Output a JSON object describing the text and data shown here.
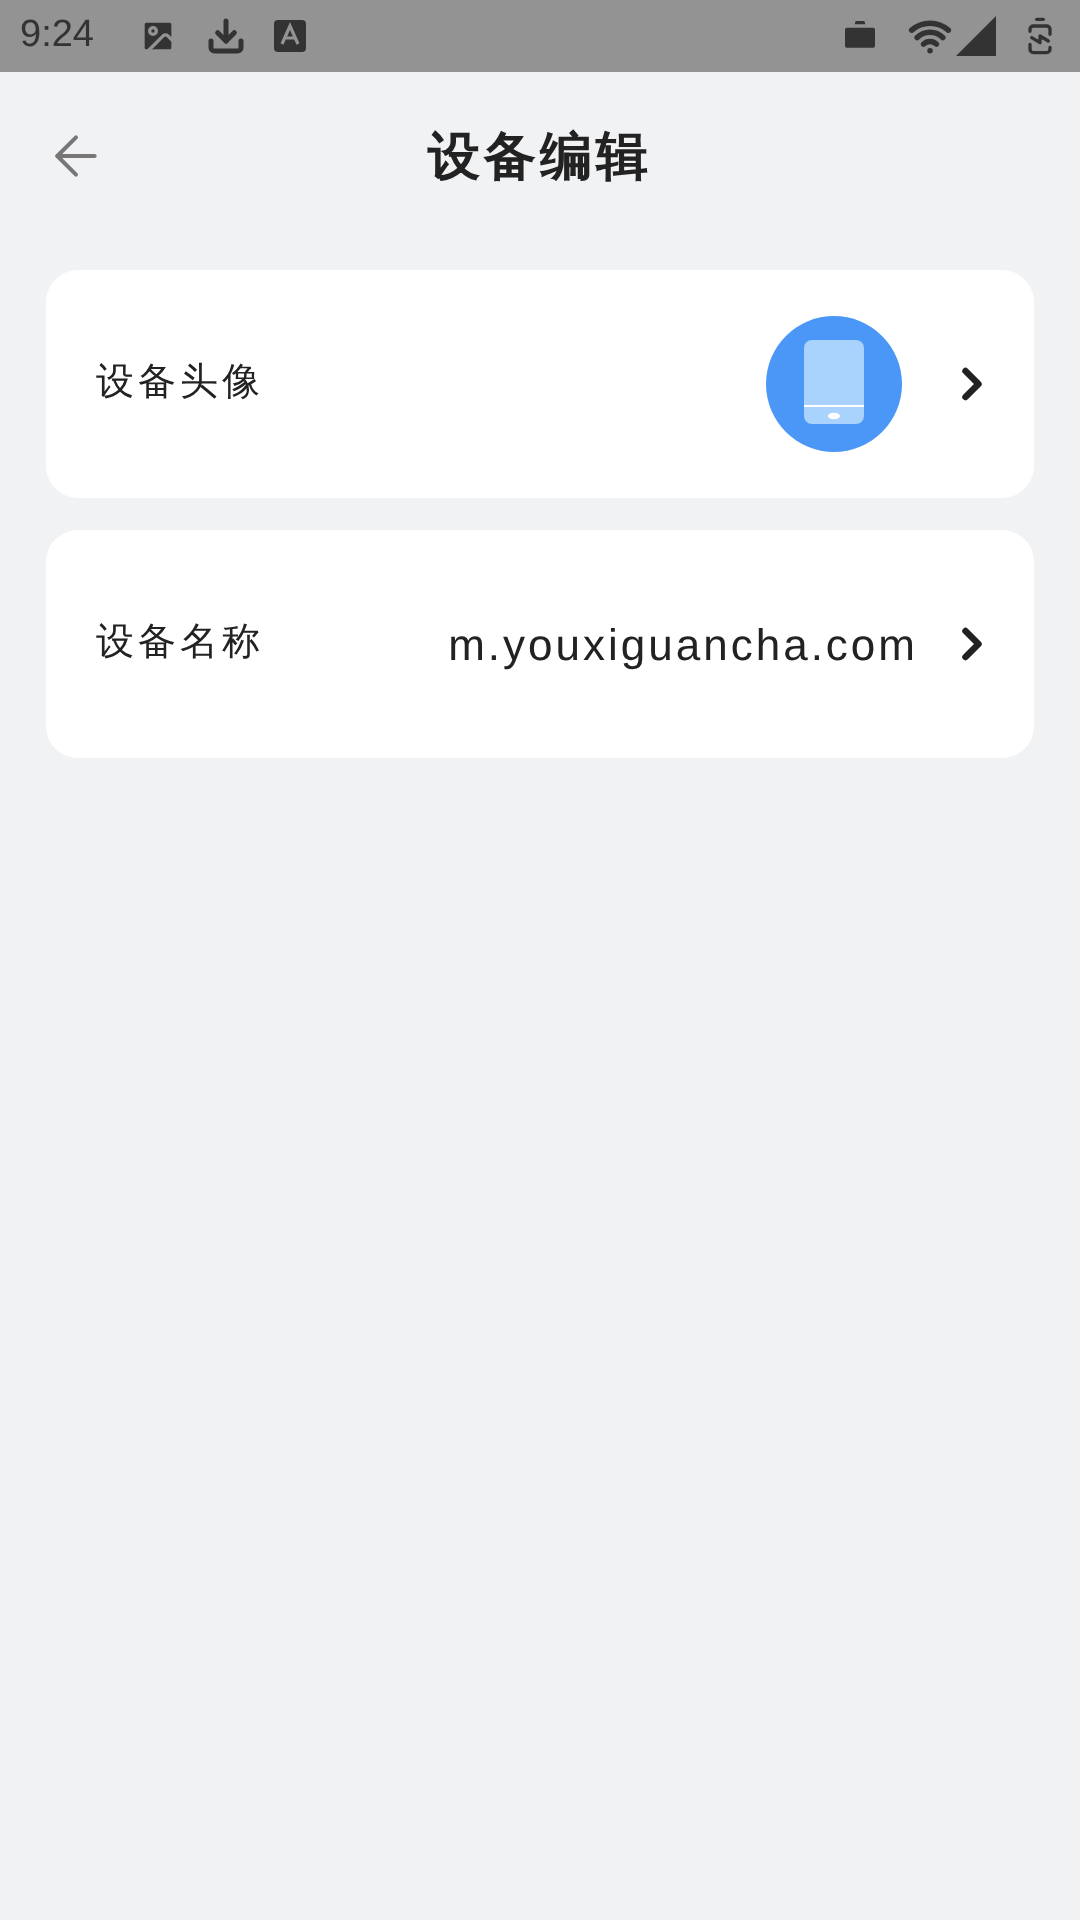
{
  "status_bar": {
    "time": "9:24"
  },
  "header": {
    "title": "设备编辑"
  },
  "rows": [
    {
      "kind": "avatar",
      "label": "设备头像"
    },
    {
      "kind": "text",
      "label": "设备名称",
      "value": "m.youxiguancha.com"
    }
  ]
}
